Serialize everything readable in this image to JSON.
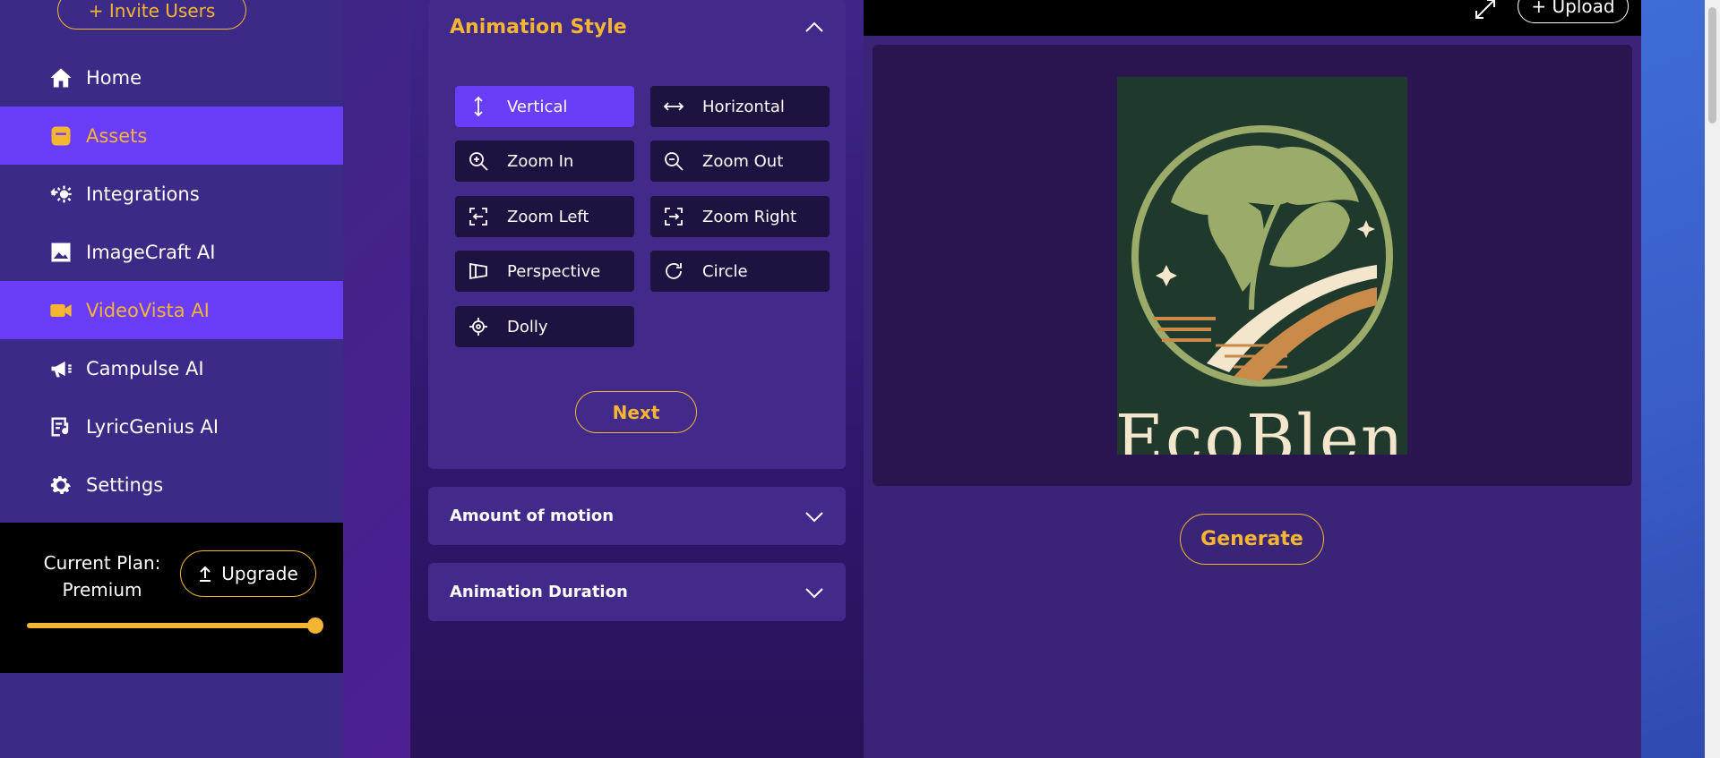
{
  "sidebar": {
    "invite_label": "+ Invite Users",
    "items": [
      {
        "label": "Home",
        "icon": "home-icon"
      },
      {
        "label": "Assets",
        "icon": "assets-icon"
      },
      {
        "label": "Integrations",
        "icon": "integrations-icon"
      },
      {
        "label": "ImageCraft AI",
        "icon": "image-icon"
      },
      {
        "label": "VideoVista AI",
        "icon": "video-icon"
      },
      {
        "label": "Campulse AI",
        "icon": "megaphone-icon"
      },
      {
        "label": "LyricGenius AI",
        "icon": "lyrics-icon"
      },
      {
        "label": "Settings",
        "icon": "gear-icon"
      }
    ],
    "plan": {
      "label_line1": "Current Plan:",
      "label_line2": "Premium",
      "upgrade_label": "Upgrade",
      "usage_fraction": 1.0
    }
  },
  "animation_style": {
    "title": "Animation Style",
    "options": [
      {
        "label": "Vertical",
        "icon": "vertical-arrows-icon",
        "selected": true
      },
      {
        "label": "Horizontal",
        "icon": "horizontal-arrows-icon",
        "selected": false
      },
      {
        "label": "Zoom In",
        "icon": "zoom-in-icon",
        "selected": false
      },
      {
        "label": "Zoom Out",
        "icon": "zoom-out-icon",
        "selected": false
      },
      {
        "label": "Zoom Left",
        "icon": "zoom-left-icon",
        "selected": false
      },
      {
        "label": "Zoom Right",
        "icon": "zoom-right-icon",
        "selected": false
      },
      {
        "label": "Perspective",
        "icon": "perspective-icon",
        "selected": false
      },
      {
        "label": "Circle",
        "icon": "circle-arrow-icon",
        "selected": false
      },
      {
        "label": "Dolly",
        "icon": "dolly-icon",
        "selected": false
      }
    ],
    "next_label": "Next"
  },
  "amount_of_motion": {
    "title": "Amount of motion"
  },
  "animation_duration": {
    "title": "Animation Duration"
  },
  "preview": {
    "upload_label": "+ Upload",
    "logo_text": "EcoBlenc",
    "generate_label": "Generate"
  },
  "colors": {
    "accent": "#f4b532",
    "active_nav": "#6a3df8",
    "panel": "#412a8a"
  }
}
